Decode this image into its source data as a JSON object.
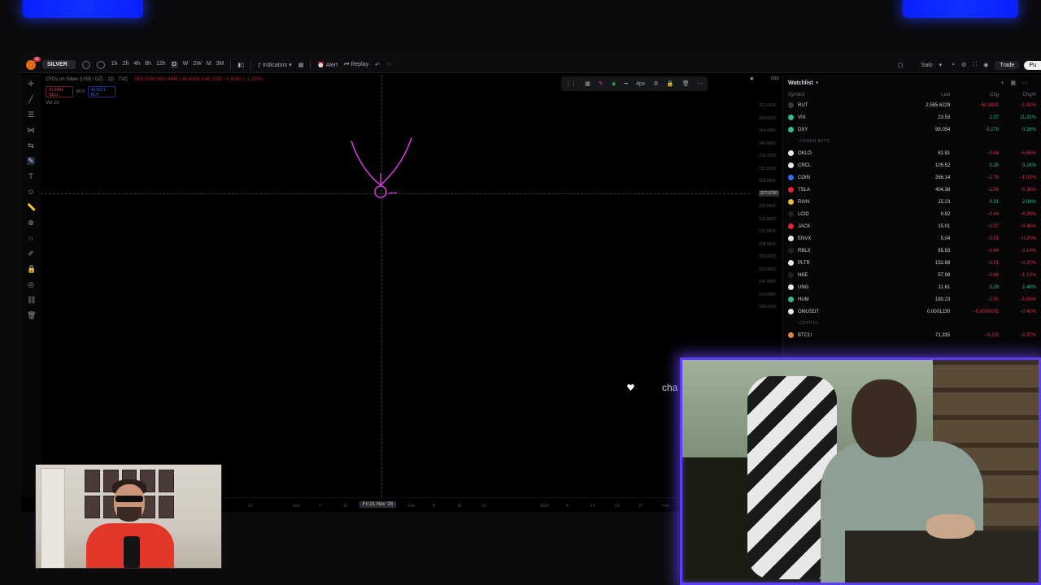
{
  "topbar": {
    "notif_count": "11",
    "symbol": "SILVER",
    "intervals": [
      "1h",
      "2h",
      "4h",
      "8h",
      "12h",
      "D",
      "W",
      "2W",
      "M",
      "3M"
    ],
    "active_interval": "D",
    "indicators": "Indicators",
    "alert": "Alert",
    "replay": "Replay",
    "layout_name": "Salo",
    "trade": "Trade",
    "publish": "Pu"
  },
  "chart": {
    "legend_title": "CFDs on Silver (US$ / OZ) · 1D · TVC",
    "legend_ohlc": "O50.0580 H50.8440 L45.4358 C48.2030 −0.5060 (−1.29%)",
    "sell_price": "41.8491",
    "sell_label": "SELL",
    "spread": "80.0",
    "buy_price": "42.0021",
    "buy_label": "BUY",
    "vol_label": "Vol 10",
    "brush_size": "4px",
    "currency": "USD",
    "cursor_price": "227.0790",
    "cursor_date": "Fri 21 Nov '25",
    "ink_color": "#d13bd6",
    "time_ticks": [
      "22",
      "Nov",
      "7",
      "12",
      "Dec",
      "8",
      "15",
      "22",
      "2026",
      "8",
      "14",
      "21",
      "27",
      "Feb"
    ],
    "price_ticks": [
      "252.0000",
      "248.0000",
      "244.0000",
      "240.0000",
      "236.0000",
      "232.0000",
      "228.0000",
      "224.0000",
      "220.0000",
      "216.0000",
      "212.0000",
      "208.0000",
      "204.0000",
      "200.0000",
      "196.0000",
      "192.0000",
      "188.0000"
    ]
  },
  "watchlist": {
    "title": "Watchlist",
    "cols": {
      "symbol": "Symbol",
      "last": "Last",
      "chg": "Chg",
      "pct": "Chg%"
    },
    "rows_top": [
      {
        "sym": "RUT",
        "last": "2,585.6229",
        "chg": "−50.3892",
        "pct": "−1.91%",
        "dir": "neg",
        "dot": "#3a3a3a"
      },
      {
        "sym": "VIX",
        "last": "23.53",
        "chg": "2.37",
        "pct": "11.21%",
        "dir": "pos",
        "dot": "#2fbf83"
      },
      {
        "sym": "DXY",
        "last": "99.054",
        "chg": "0.279",
        "pct": "0.28%",
        "dir": "pos",
        "dot": "#2fbf83"
      }
    ],
    "section_label": "ORDEN BETS",
    "rows_mid": [
      {
        "sym": "OKLO",
        "last": "61.81",
        "chg": "−3.84",
        "pct": "−5.85%",
        "dir": "neg",
        "dot": "#e8e8e8"
      },
      {
        "sym": "CRCL",
        "last": "105.52",
        "chg": "0.25",
        "pct": "0.24%",
        "dir": "pos",
        "dot": "#e8e8e8"
      },
      {
        "sym": "COIN",
        "last": "266.14",
        "chg": "−2.76",
        "pct": "−1.03%",
        "dir": "neg",
        "dot": "#2f6bff"
      },
      {
        "sym": "TSLA",
        "last": "404.38",
        "chg": "−1.56",
        "pct": "−0.38%",
        "dir": "neg",
        "dot": "#e0263b"
      },
      {
        "sym": "RIVN",
        "last": "15.23",
        "chg": "0.31",
        "pct": "2.08%",
        "dir": "pos",
        "dot": "#e8b83a"
      },
      {
        "sym": "LCID",
        "last": "9.82",
        "chg": "−0.44",
        "pct": "−4.28%",
        "dir": "neg",
        "dot": "#222"
      },
      {
        "sym": "JACK",
        "last": "15.01",
        "chg": "−0.07",
        "pct": "−0.46%",
        "dir": "neg",
        "dot": "#e0263b"
      },
      {
        "sym": "ENVX",
        "last": "5.04",
        "chg": "−0.01",
        "pct": "−0.20%",
        "dir": "neg",
        "dot": "#e8e8e8"
      },
      {
        "sym": "RBLX",
        "last": "65.93",
        "chg": "−1.44",
        "pct": "−2.14%",
        "dir": "neg",
        "dot": "#222"
      },
      {
        "sym": "PLTR",
        "last": "152.88",
        "chg": "−0.31",
        "pct": "−0.20%",
        "dir": "neg",
        "dot": "#e8e8e8"
      },
      {
        "sym": "NKE",
        "last": "57.98",
        "chg": "−0.66",
        "pct": "−1.13%",
        "dir": "neg",
        "dot": "#222"
      },
      {
        "sym": "UNG",
        "last": "11.61",
        "chg": "0.29",
        "pct": "2.46%",
        "dir": "pos",
        "dot": "#e8e8e8"
      },
      {
        "sym": "HUM",
        "last": "180.23",
        "chg": "−2.91",
        "pct": "−1.59%",
        "dir": "neg",
        "dot": "#2fbf83"
      },
      {
        "sym": "OMUSDT",
        "last": "0.0001230",
        "chg": "−0.0000005",
        "pct": "−0.40%",
        "dir": "neg",
        "dot": "#e8e8e8"
      }
    ],
    "section2_label": "CRYPTO",
    "rows_bottom": [
      {
        "sym": "BTC1!",
        "last": "71,335",
        "chg": "−3,115",
        "pct": "−2.97%",
        "dir": "neg",
        "dot": "#e8843a"
      }
    ]
  },
  "overlay": {
    "chat_text": "cha",
    "frame_color": "#5b3dff"
  }
}
